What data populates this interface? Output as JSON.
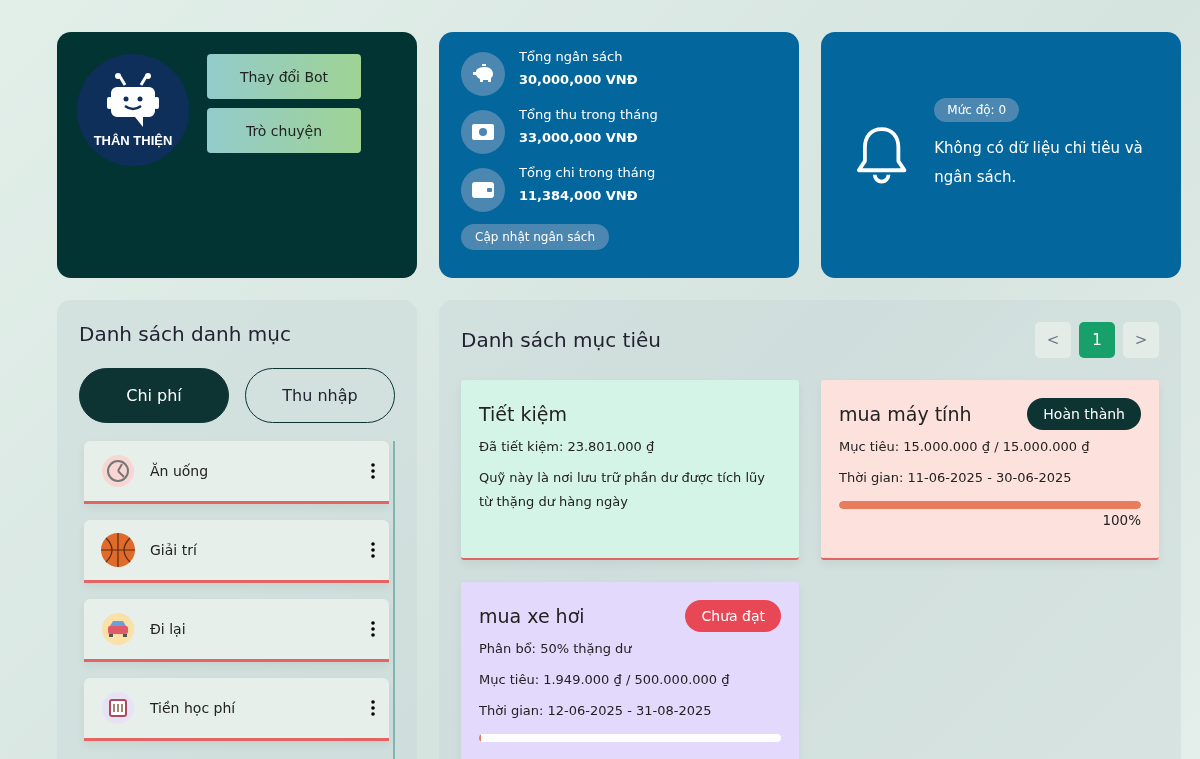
{
  "bot": {
    "badge": "THÂN THIỆN",
    "buttons": [
      "Thay đổi Bot",
      "Trò chuyện"
    ]
  },
  "budget": {
    "items": [
      {
        "kind": "piggy",
        "label": "Tổng ngân sách",
        "value": "30,000,000 VNĐ"
      },
      {
        "kind": "cash",
        "label": "Tổng thu trong tháng",
        "value": "33,000,000 VNĐ"
      },
      {
        "kind": "wallet",
        "label": "Tổng chi trong tháng",
        "value": "11,384,000 VNĐ"
      }
    ],
    "button": "Cập nhật ngân sách"
  },
  "alert": {
    "level_badge": "Mức độ: 0",
    "message": "Không có dữ liệu chi tiêu và ngân sách."
  },
  "categories": {
    "title": "Danh sách danh mục",
    "tabs": [
      {
        "label": "Chi phí",
        "selected": true
      },
      {
        "label": "Thu nhập",
        "selected": false
      }
    ],
    "items": [
      {
        "kind": "food",
        "name": "Ăn uống"
      },
      {
        "kind": "ball",
        "name": "Giải trí"
      },
      {
        "kind": "car",
        "name": "Đi lại"
      },
      {
        "kind": "book",
        "name": "Tiền học phí"
      }
    ]
  },
  "goals": {
    "title": "Danh sách mục tiêu",
    "pagination": {
      "prev": "<",
      "pages": [
        {
          "label": "1",
          "selected": true
        }
      ],
      "next": ">"
    },
    "cards": [
      {
        "kind": "savings",
        "title": "Tiết kiệm",
        "lines": [
          "Đã tiết kiệm: 23.801.000 ₫",
          "Quỹ này là nơi lưu trữ phần dư được tích lũy từ thặng dư hàng ngày"
        ]
      },
      {
        "kind": "goal",
        "title": "mua máy tính",
        "completed": true,
        "status_label": "Hoàn thành",
        "lines": [
          "Mục tiêu: 15.000.000 ₫ / 15.000.000 ₫",
          "Thời gian: 11-06-2025 - 30-06-2025"
        ],
        "level": 1,
        "percent": "100%"
      },
      {
        "kind": "goal",
        "title": "mua xe hơi",
        "completed": false,
        "status_label": "Chưa đạt",
        "lines": [
          "Phân bổ: 50% thặng dư",
          "Mục tiêu: 1.949.000 ₫ / 500.000.000 ₫",
          "Thời gian: 12-06-2025 - 31-08-2025"
        ],
        "level": 0.004
      }
    ]
  }
}
